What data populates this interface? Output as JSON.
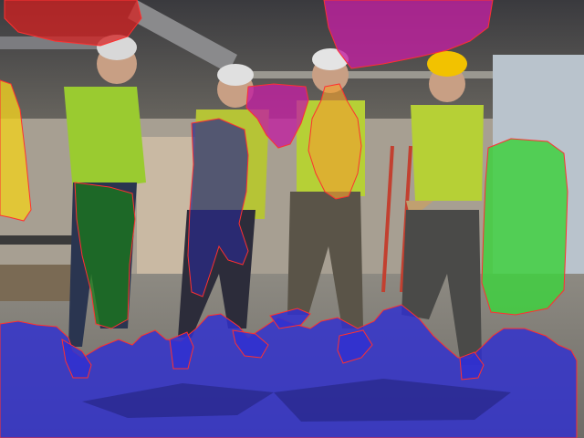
{
  "image": {
    "kind": "photo-with-segmentation-overlay",
    "subjects": [
      "worker-1",
      "worker-2",
      "worker-3",
      "worker-4"
    ],
    "mask_colors": {
      "red": "#d42020",
      "magenta": "#c020a0",
      "yellow": "#f0d020",
      "dark_green": "#1a7a1a",
      "navy": "#2a2a8a",
      "orange": "#f0a030",
      "green": "#40d040",
      "blue": "#3030d0",
      "outline": "#ff3030"
    }
  }
}
